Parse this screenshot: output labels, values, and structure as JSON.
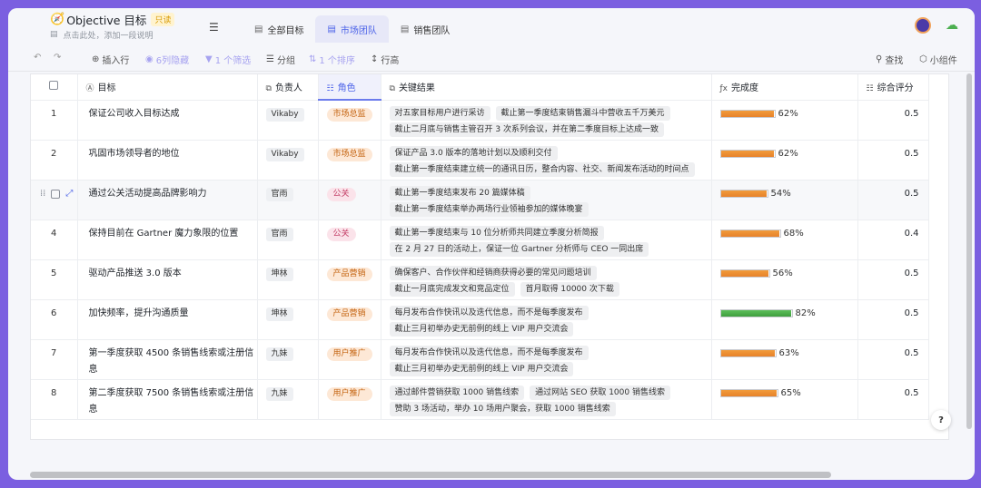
{
  "header": {
    "title": "Objective 目标",
    "readonly_badge": "只读",
    "description_placeholder": "点击此处，添加一段说明"
  },
  "tabs": [
    {
      "label": "全部目标",
      "active": false
    },
    {
      "label": "市场团队",
      "active": true
    },
    {
      "label": "销售团队",
      "active": false
    }
  ],
  "toolbar": {
    "insert_row": "插入行",
    "hidden_cols": "6列隐藏",
    "filter": "1 个筛选",
    "group": "分组",
    "sort": "1 个排序",
    "row_height": "行高",
    "search": "查找",
    "widget": "小组件"
  },
  "columns": {
    "goal": "目标",
    "owner": "负责人",
    "role": "角色",
    "key_results": "关键结果",
    "completion": "完成度",
    "score": "综合评分"
  },
  "rows": [
    {
      "num": "1",
      "goal": "保证公司收入目标达成",
      "owner": "Vikaby",
      "role": "市场总监",
      "role_style": "orange",
      "krs": [
        "对五家目标用户进行采访",
        "截止第一季度结束销售漏斗中营收五千万美元",
        "截止二月底与销售主管召开 3 次系列会议，并在第二季度目标上达成一致"
      ],
      "progress_label": "62%",
      "progress": 0.62,
      "score": "0.5"
    },
    {
      "num": "2",
      "goal": "巩固市场领导者的地位",
      "owner": "Vikaby",
      "role": "市场总监",
      "role_style": "orange",
      "krs": [
        "保证产品 3.0 版本的落地计划以及顺利交付",
        "截止第一季度结束建立统一的通讯日历，整合内容、社交、新闻发布活动的时间点"
      ],
      "progress_label": "62%",
      "progress": 0.62,
      "score": "0.5"
    },
    {
      "num": "",
      "goal": "通过公关活动提高品牌影响力",
      "owner": "官雨",
      "role": "公关",
      "role_style": "pink",
      "krs": [
        "截止第一季度结束发布 20 篇媒体稿",
        "截止第一季度结束举办两场行业领袖参加的媒体晚宴"
      ],
      "progress_label": "54%",
      "progress": 0.54,
      "score": "0.5"
    },
    {
      "num": "4",
      "goal": "保持目前在 Gartner 魔力象限的位置",
      "owner": "官雨",
      "role": "公关",
      "role_style": "pink",
      "krs": [
        "截止第一季度结束与 10 位分析师共同建立季度分析简报",
        "在 2 月 27 日的活动上，保证一位 Gartner 分析师与 CEO 一同出席"
      ],
      "progress_label": "68%",
      "progress": 0.68,
      "score": "0.4"
    },
    {
      "num": "5",
      "goal": "驱动产品推送 3.0 版本",
      "owner": "坤林",
      "role": "产品营销",
      "role_style": "orange",
      "krs": [
        "确保客户、合作伙伴和经销商获得必要的常见问题培训",
        "截止一月底完成发文和竞品定位",
        "首月取得 10000 次下载"
      ],
      "progress_label": "56%",
      "progress": 0.56,
      "score": "0.5"
    },
    {
      "num": "6",
      "goal": "加快频率，提升沟通质量",
      "owner": "坤林",
      "role": "产品营销",
      "role_style": "orange",
      "krs": [
        "每月发布合作快讯以及迭代信息，而不是每季度发布",
        "截止三月初举办史无前例的线上 VIP 用户交流会"
      ],
      "progress_label": "82%",
      "progress": 0.82,
      "score": "0.5",
      "green": true
    },
    {
      "num": "7",
      "goal": "第一季度获取 4500 条销售线索或注册信息",
      "owner": "九妹",
      "role": "用户推广",
      "role_style": "orange",
      "krs": [
        "每月发布合作快讯以及迭代信息，而不是每季度发布",
        "截止三月初举办史无前例的线上 VIP 用户交流会"
      ],
      "progress_label": "63%",
      "progress": 0.63,
      "score": "0.5"
    },
    {
      "num": "8",
      "goal": "第二季度获取 7500 条销售线索或注册信息",
      "owner": "九妹",
      "role": "用户推广",
      "role_style": "orange",
      "krs": [
        "通过邮件营销获取 1000 销售线索",
        "通过网站 SEO 获取 1000 销售线索",
        "赞助 3 场活动，举办 10 场用户聚会，获取 1000 销售线索"
      ],
      "progress_label": "65%",
      "progress": 0.65,
      "score": "0.5"
    }
  ],
  "help_label": "?"
}
